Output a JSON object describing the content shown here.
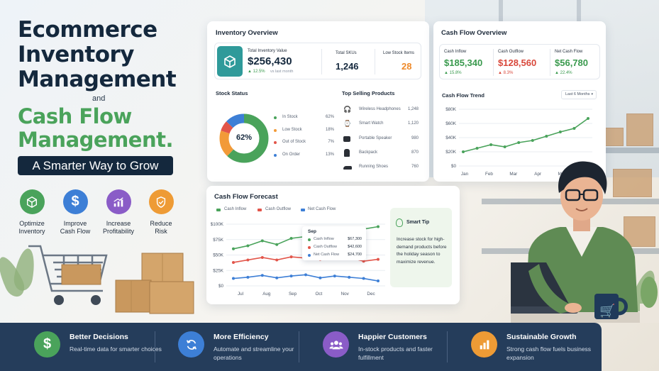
{
  "hero": {
    "title_lines": [
      "Ecommerce",
      "Inventory",
      "Management"
    ],
    "and": "and",
    "title2_lines": [
      "Cash Flow",
      "Management."
    ],
    "tagline": "A Smarter Way to Grow"
  },
  "features": [
    {
      "label1": "Optimize",
      "label2": "Inventory",
      "icon": "box-icon",
      "color": "#4aa35b"
    },
    {
      "label1": "Improve",
      "label2": "Cash Flow",
      "icon": "dollar-icon",
      "color": "#3d7fd6"
    },
    {
      "label1": "Increase",
      "label2": "Profitability",
      "icon": "chart-icon",
      "color": "#8a5cc7"
    },
    {
      "label1": "Reduce",
      "label2": "Risk",
      "icon": "shield-icon",
      "color": "#ee9b35"
    }
  ],
  "inventory": {
    "title": "Inventory Overview",
    "total_value_label": "Total Inventory Value",
    "total_value": "$256,430",
    "total_value_change": "▲ 12.5%",
    "total_value_period": "vs last month",
    "skus_label": "Total SKUs",
    "skus": "1,246",
    "low_stock_label": "Low Stock Items",
    "low_stock": "28",
    "stock_status_title": "Stock Status",
    "donut_center": "62%",
    "stock_status": [
      {
        "label": "In Stock",
        "value": "62%",
        "color": "#4aa35b"
      },
      {
        "label": "Low Stock",
        "value": "18%",
        "color": "#f29a38"
      },
      {
        "label": "Out of Stock",
        "value": "7%",
        "color": "#e2554a"
      },
      {
        "label": "On Order",
        "value": "13%",
        "color": "#3d7fd6"
      }
    ],
    "top_selling_title": "Top Selling Products",
    "top_selling": [
      {
        "name": "Wireless Headphones",
        "qty": "1,248",
        "icon": "headphones-icon"
      },
      {
        "name": "Smart Watch",
        "qty": "1,120",
        "icon": "watch-icon"
      },
      {
        "name": "Portable Speaker",
        "qty": "980",
        "icon": "speaker-icon"
      },
      {
        "name": "Backpack",
        "qty": "870",
        "icon": "backpack-icon"
      },
      {
        "name": "Running Shoes",
        "qty": "760",
        "icon": "shoe-icon"
      }
    ]
  },
  "cashflow": {
    "title": "Cash Flow Overview",
    "inflow_label": "Cash Inflow",
    "inflow": "$185,340",
    "inflow_change": "▲ 15.8%",
    "outflow_label": "Cash Outflow",
    "outflow": "$128,560",
    "outflow_change": "▲ 8.3%",
    "net_label": "Net Cash Flow",
    "net": "$56,780",
    "net_change": "▲ 22.4%",
    "trend_title": "Cash Flow Trend",
    "trend_select": "Last 6 Months",
    "trend_select_icon": "chevron-down-icon"
  },
  "forecast": {
    "title": "Cash Flow Forecast",
    "legend": [
      {
        "label": "Cash Inflow",
        "color": "#4aa35b"
      },
      {
        "label": "Cash Outflow",
        "color": "#e2554a"
      },
      {
        "label": "Net Cash Flow",
        "color": "#3d7fd6"
      }
    ],
    "tooltip": {
      "month": "Sep",
      "rows": [
        {
          "label": "Cash Inflow",
          "value": "$67,300",
          "color": "#4aa35b"
        },
        {
          "label": "Cash Outflow",
          "value": "$42,600",
          "color": "#e2554a"
        },
        {
          "label": "Net Cash Flow",
          "value": "$24,700",
          "color": "#3d7fd6"
        }
      ]
    },
    "tip_title": "Smart Tip",
    "tip_text": "Increase stock for high-demand products before the holiday season to maximize revenue."
  },
  "chart_data": [
    {
      "type": "pie",
      "title": "Stock Status",
      "categories": [
        "In Stock",
        "Low Stock",
        "Out of Stock",
        "On Order"
      ],
      "values": [
        62,
        18,
        7,
        13
      ],
      "colors": [
        "#4aa35b",
        "#f29a38",
        "#e2554a",
        "#3d7fd6"
      ]
    },
    {
      "type": "line",
      "title": "Cash Flow Trend",
      "categories": [
        "Jan",
        "Feb",
        "Mar",
        "Apr",
        "May",
        "Jun"
      ],
      "series": [
        {
          "values": [
            20000,
            25000,
            30000,
            27000,
            33000,
            36000,
            42000,
            48000,
            53000,
            67000
          ]
        }
      ],
      "x_points": 10,
      "y_ticks": [
        "$0",
        "$20K",
        "$40K",
        "$60K",
        "$80K"
      ],
      "ylim": [
        0,
        80000
      ],
      "color": "#4aa35b",
      "grid": true
    },
    {
      "type": "line",
      "title": "Cash Flow Forecast",
      "categories": [
        "Jul",
        "Aug",
        "Sep",
        "Oct",
        "Nov",
        "Dec"
      ],
      "series": [
        {
          "name": "Cash Inflow",
          "values": [
            60000,
            65000,
            73000,
            67000,
            77000,
            80000,
            73000,
            82000,
            88000,
            92000,
            96000
          ],
          "color": "#4aa35b"
        },
        {
          "name": "Cash Outflow",
          "values": [
            38000,
            42000,
            46000,
            42000,
            47000,
            45000,
            43000,
            48000,
            46000,
            40000,
            43000
          ],
          "color": "#e2554a"
        },
        {
          "name": "Net Cash Flow",
          "values": [
            12000,
            14000,
            17000,
            13000,
            16000,
            18000,
            13000,
            16000,
            14000,
            12000,
            8000
          ],
          "color": "#3d7fd6"
        }
      ],
      "y_ticks": [
        "$0",
        "$25K",
        "$50K",
        "$75K",
        "$100K"
      ],
      "ylim": [
        0,
        100000
      ],
      "grid": true
    }
  ],
  "bottom": [
    {
      "title": "Better Decisions",
      "text": "Real-time data for smarter choices",
      "icon": "dollar-icon",
      "color": "#4aa35b"
    },
    {
      "title": "More Efficiency",
      "text": "Automate and streamline your operations",
      "icon": "refresh-icon",
      "color": "#3d7fd6"
    },
    {
      "title": "Happier Customers",
      "text": "In-stock products and faster fulfillment",
      "icon": "users-icon",
      "color": "#8a5cc7"
    },
    {
      "title": "Sustainable Growth",
      "text": "Strong cash flow fuels business expansion",
      "icon": "bar-chart-icon",
      "color": "#ee9b35"
    }
  ]
}
